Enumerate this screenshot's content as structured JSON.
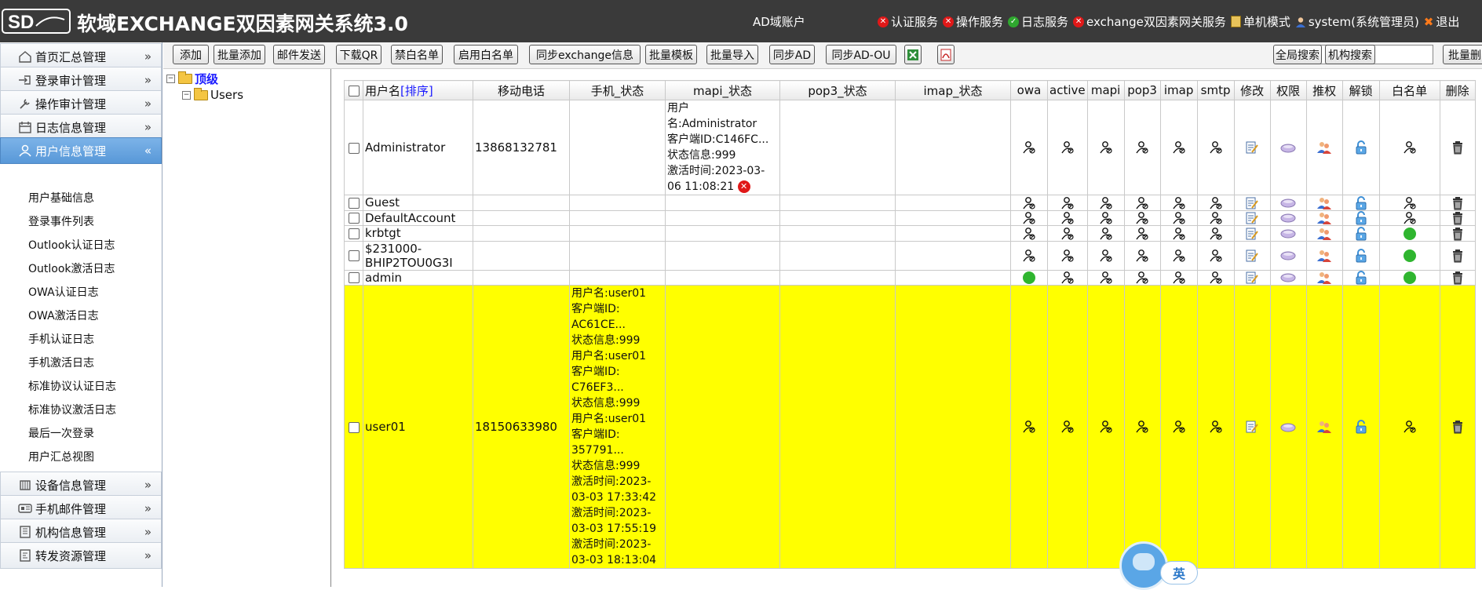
{
  "header": {
    "logo_text": "SD",
    "title": "软域EXCHANGE双因素网关系统3.0",
    "domain_account": "AD域账户",
    "status": [
      {
        "label": "认证服务",
        "state": "error"
      },
      {
        "label": "操作服务",
        "state": "error"
      },
      {
        "label": "日志服务",
        "state": "ok"
      },
      {
        "label": "exchange双因素网关服务",
        "state": "error"
      },
      {
        "label": "单机模式",
        "state": "mode"
      },
      {
        "label": "system(系统管理员)",
        "state": "user"
      },
      {
        "label": "退出",
        "state": "exit"
      }
    ]
  },
  "sidebar": {
    "items": [
      {
        "label": "首页汇总管理",
        "icon": "home-icon"
      },
      {
        "label": "登录审计管理",
        "icon": "login-icon"
      },
      {
        "label": "操作审计管理",
        "icon": "wrench-icon"
      },
      {
        "label": "日志信息管理",
        "icon": "calendar-icon"
      },
      {
        "label": "用户信息管理",
        "icon": "user-icon",
        "active": true
      },
      {
        "label": "设备信息管理",
        "icon": "device-icon"
      },
      {
        "label": "手机邮件管理",
        "icon": "phone-mail-icon"
      },
      {
        "label": "机构信息管理",
        "icon": "org-icon"
      },
      {
        "label": "转发资源管理",
        "icon": "forward-icon"
      }
    ],
    "subitems": [
      "用户基础信息",
      "登录事件列表",
      "Outlook认证日志",
      "Outlook激活日志",
      "OWA认证日志",
      "OWA激活日志",
      "手机认证日志",
      "手机激活日志",
      "标准协议认证日志",
      "标准协议激活日志",
      "最后一次登录",
      "用户汇总视图"
    ]
  },
  "toolbar": {
    "buttons": [
      "添加",
      "批量添加",
      "邮件发送",
      "下载QR",
      "禁白名单",
      "启用白名单",
      "同步exchange信息",
      "批量模板",
      "批量导入",
      "同步AD",
      "同步AD-OU"
    ],
    "search_placeholder": ".....",
    "global_search": "全局搜索",
    "org_search": "机构搜索",
    "batch_delete": "批量删除"
  },
  "tree": {
    "root": "顶级",
    "child": "Users"
  },
  "table": {
    "headers": {
      "username": "用户名",
      "sort": "[排序]",
      "mobile": "移动电话",
      "phone_status": "手机_状态",
      "mapi_status": "mapi_状态",
      "pop3_status": "pop3_状态",
      "imap_status": "imap_状态",
      "owa": "owa",
      "active": "active",
      "mapi": "mapi",
      "pop3": "pop3",
      "imap": "imap",
      "smtp": "smtp",
      "edit": "修改",
      "perm": "权限",
      "grant": "推权",
      "unlock": "解锁",
      "whitelist": "白名单",
      "delete": "删除"
    },
    "rows": [
      {
        "name": "Administrator",
        "mobile": "13868132781",
        "phone_status": [],
        "mapi_status": [
          "用户",
          "名:Administrator",
          "客户端ID:C146FC...",
          "状态信息:999",
          "激活时间:2023-03-",
          "06 11:08:21"
        ],
        "mapi_error": true,
        "owa_green": false,
        "white_green": false,
        "highlight": false
      },
      {
        "name": "Guest",
        "mobile": "",
        "phone_status": [],
        "mapi_status": [],
        "owa_green": false,
        "white_green": false,
        "highlight": false
      },
      {
        "name": "DefaultAccount",
        "mobile": "",
        "phone_status": [],
        "mapi_status": [],
        "owa_green": false,
        "white_green": false,
        "highlight": false
      },
      {
        "name": "krbtgt",
        "mobile": "",
        "phone_status": [],
        "mapi_status": [],
        "owa_green": false,
        "white_green": true,
        "highlight": false
      },
      {
        "name": "$231000-BHIP2TOU0G3I",
        "name_lines": [
          "$231000-",
          "BHIP2TOU0G3I"
        ],
        "mobile": "",
        "phone_status": [],
        "mapi_status": [],
        "owa_green": false,
        "white_green": true,
        "highlight": false
      },
      {
        "name": "admin",
        "mobile": "",
        "phone_status": [],
        "mapi_status": [],
        "owa_green": true,
        "white_green": true,
        "highlight": false
      },
      {
        "name": "user01",
        "mobile": "18150633980",
        "phone_status": [
          "用户名:user01",
          "客户端ID:",
          "AC61CE...",
          "状态信息:999",
          "用户名:user01",
          "客户端ID:",
          "C76EF3...",
          "状态信息:999",
          "用户名:user01",
          "客户端ID:",
          "357791...",
          "状态信息:999",
          "激活时间:2023-",
          "03-03 17:33:42",
          "激活时间:2023-",
          "03-03 17:55:19",
          "激活时间:2023-",
          "03-03 18:13:04"
        ],
        "mapi_status": [],
        "owa_green": false,
        "white_green": false,
        "highlight": true
      }
    ]
  },
  "ime": {
    "label": "英"
  }
}
